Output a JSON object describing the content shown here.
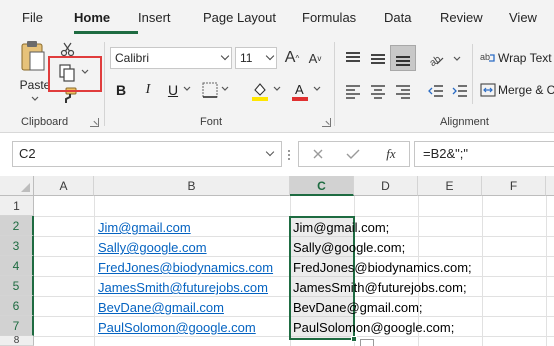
{
  "tabs": [
    "File",
    "Home",
    "Insert",
    "Page Layout",
    "Formulas",
    "Data",
    "Review",
    "View"
  ],
  "ribbon": {
    "clipboard": {
      "paste_label": "Paste",
      "group_label": "Clipboard"
    },
    "font": {
      "font_name": "Calibri",
      "font_size": "11",
      "group_label": "Font"
    },
    "alignment": {
      "wrap_text_label": "Wrap Text",
      "merge_label": "Merge & C",
      "group_label": "Alignment"
    }
  },
  "formula_bar": {
    "name_box": "C2",
    "fx_label": "fx",
    "formula": "=B2&\";\""
  },
  "grid": {
    "columns": [
      "A",
      "B",
      "C",
      "D",
      "E",
      "F"
    ],
    "rows": [
      "1",
      "2",
      "3",
      "4",
      "5",
      "6",
      "7",
      "8"
    ],
    "selected_column": "C",
    "emails": [
      "Jim@gmail.com",
      "Sally@google.com",
      "FredJones@biodynamics.com",
      "JamesSmith@futurejobs.com",
      "BevDane@gmail.com",
      "PaulSolomon@google.com"
    ],
    "results": [
      "Jim@gmail.com;",
      "Sally@google.com;",
      "FredJones@biodynamics.com;",
      "JamesSmith@futurejobs.com;",
      "BevDane@gmail.com;",
      "PaulSolomon@google.com;"
    ]
  },
  "colors": {
    "accent": "#1e6b41",
    "link": "#0563c1",
    "highlight_box": "#e03c3c",
    "font_color_bar": "#e03030",
    "fill_color_bar": "#ffe600"
  }
}
